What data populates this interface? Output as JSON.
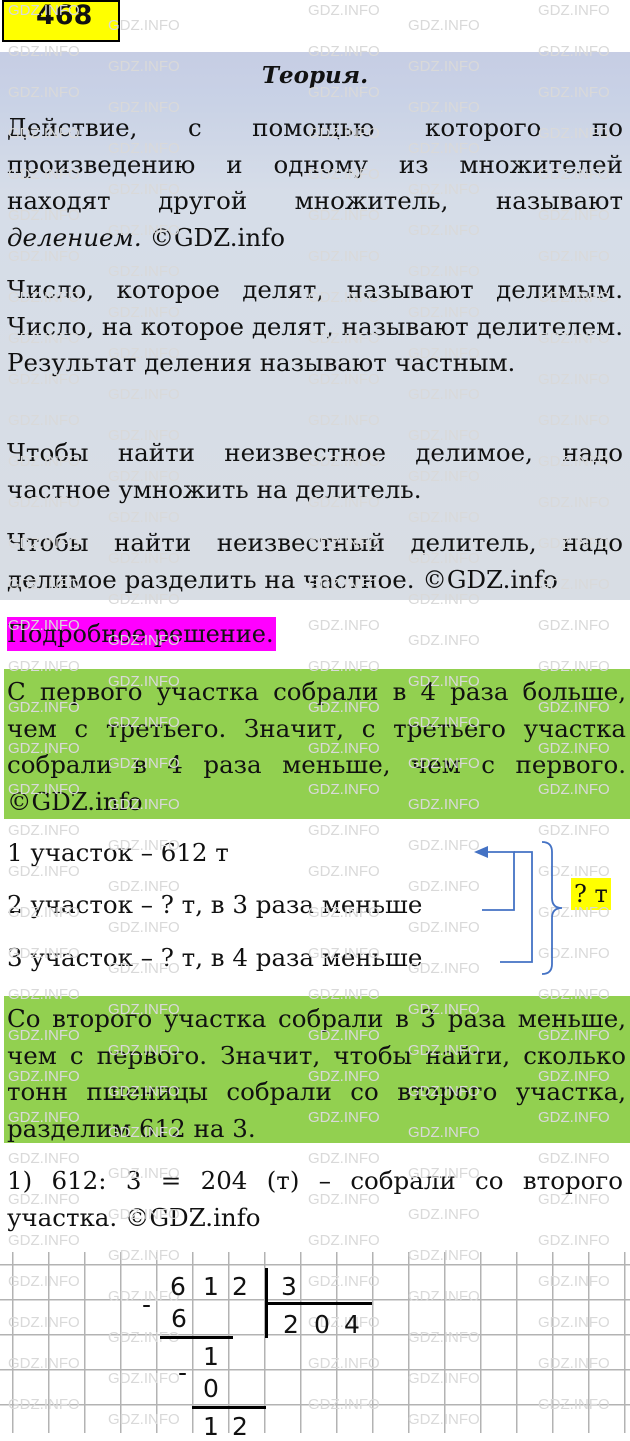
{
  "task_number": "468",
  "theory": {
    "title": "Теория.",
    "paragraphs": [
      {
        "text": "Действие, с помощью которого по произведению и одному из множителей находят другой множитель, называют ",
        "italic": "делением.",
        "tail": " ©GDZ.info"
      },
      {
        "text": "Число, которое делят, называют делимым. Число, на которое делят, называют делителем. Результат деления называют частным."
      },
      {
        "text": "Чтобы найти неизвестное делимое, надо частное умножить на делитель."
      },
      {
        "text": "Чтобы найти неизвестный делитель, надо делимое разделить на частное. ©GDZ.info"
      }
    ]
  },
  "solution_label": "Подробное решение.",
  "explanation_1": "С первого участка собрали в 4 раза больше, чем с третьего. Значит, с третьего участка собрали в 4 раза меньше, чем с первого. ©GDZ.info",
  "condition": {
    "lines": [
      "1 участок – 612 т",
      "2 участок – ? т, в 3 раза меньше",
      "3 участок – ? т, в 4 раза меньше"
    ],
    "total_label": "? т"
  },
  "explanation_2": "Со второго участка собрали в 3 раза меньше, чем с первого. Значит, чтобы найти, сколько тонн пшеницы собрали со второго участка, разделим 612 на 3.",
  "step_1": "1) 612: 3 = 204  (т)  –  собрали со второго участка. ©GDZ.info",
  "long_division": {
    "dividend": [
      "6",
      "1",
      "2"
    ],
    "divisor": "3",
    "quotient": [
      "2",
      "0",
      "4"
    ],
    "step1_subtract": "6",
    "step2_remainder": "1",
    "step2_subtract": "0",
    "step3_remainder": [
      "1",
      "2"
    ],
    "minus": "-"
  },
  "watermark": "GDZ.INFO",
  "colors": {
    "badge": "#ffff00",
    "theory_bg": "#d6dde8",
    "solution_label_bg": "#ff00ff",
    "explanation_bg": "#92d050",
    "arrow": "#4472c4"
  }
}
